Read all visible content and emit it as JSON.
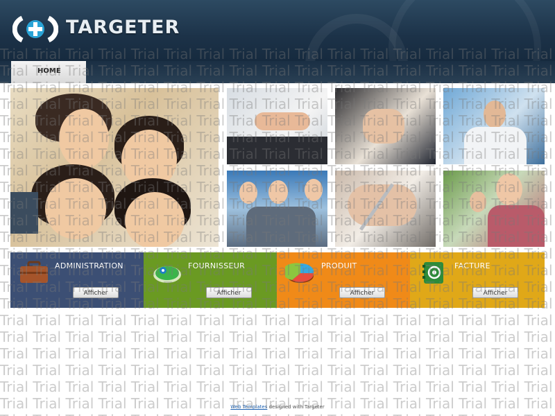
{
  "header": {
    "title": "TARGETER"
  },
  "nav": {
    "items": [
      {
        "label": "HOME"
      }
    ]
  },
  "panels": [
    {
      "title": "ADMINISTRATION",
      "button": "Afficher",
      "color": "#3c4f74",
      "icon": "briefcase-icon"
    },
    {
      "title": "FOURNISSEUR",
      "button": "Afficher",
      "color": "#6a9a22",
      "icon": "globe-disc-icon"
    },
    {
      "title": "PRODUIT",
      "button": "Afficher",
      "color": "#f08a18",
      "icon": "pie-chart-icon"
    },
    {
      "title": "FACTURE",
      "button": "Afficher",
      "color": "#e0a818",
      "icon": "address-book-icon"
    }
  ],
  "footer": {
    "link": "Web Templates",
    "text": "designed with Targeter"
  },
  "watermark": {
    "word": "Trial"
  }
}
